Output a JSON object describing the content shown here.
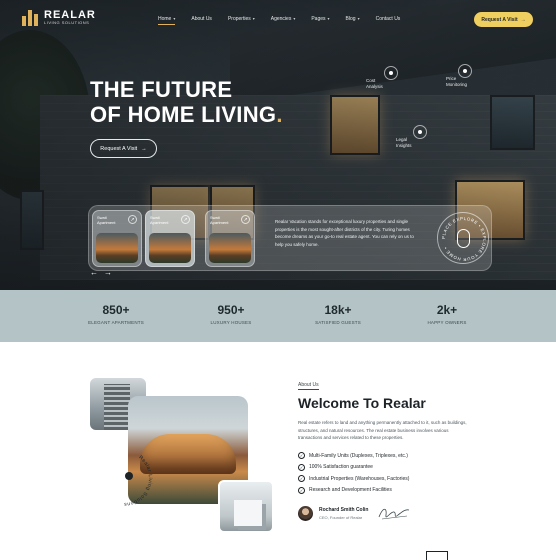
{
  "brand": {
    "name": "REALAR",
    "tagline": "LIVING SOLUTIONS",
    "accent": "#e0b25c",
    "cta_color": "#f0cf61"
  },
  "nav": {
    "items": [
      {
        "label": "Home",
        "dropdown": true,
        "active": true
      },
      {
        "label": "About Us",
        "dropdown": false
      },
      {
        "label": "Properties",
        "dropdown": true
      },
      {
        "label": "Agencies",
        "dropdown": true
      },
      {
        "label": "Pages",
        "dropdown": true
      },
      {
        "label": "Blog",
        "dropdown": true
      },
      {
        "label": "Contact Us",
        "dropdown": false
      }
    ],
    "cta_label": "Request A Visit",
    "caret": "▾",
    "arrow": "→"
  },
  "hero": {
    "title_line1": "THE FUTURE",
    "title_line2": "OF HOME LIVING",
    "title_dot": ".",
    "button_label": "Request A Visit",
    "hotspots": [
      {
        "label": "Cost Analysis"
      },
      {
        "label": "Price Monitoring"
      },
      {
        "label": "Legal Insights"
      }
    ],
    "cards": [
      {
        "label": "Swati Apartment"
      },
      {
        "label": "Swati Apartment"
      },
      {
        "label": "Swati Apartment"
      }
    ],
    "description": "Realar Vacation stands for exceptional luxury properties and single properties is the most sought-after districts of the city. Turing homes become dreams as your go-to real estate agent. You can rely on us to help you safely home.",
    "explore_text": "PLACE EXPLORE • EXPLORE YOUR HOME •",
    "slider_prev": "←",
    "slider_next": "→"
  },
  "stats": [
    {
      "value": "850+",
      "label": "ELEGANT APARTMENTS"
    },
    {
      "value": "950+",
      "label": "LUXURY HOUSES"
    },
    {
      "value": "18k+",
      "label": "SATISFIED GUESTS"
    },
    {
      "value": "2k+",
      "label": "HAPPY OWNERS"
    }
  ],
  "about": {
    "tag": "About Us",
    "title": "Welcome To Realar",
    "description": "Real estate refers to land and anything permanently attached to it, such as buildings, structures, and natural resources. The real estate business involves various transactions and services related to these properties.",
    "ring_text": "Realar Living Solutions",
    "features": [
      "Multi-Family Units (Duplexes, Triplexes, etc.)",
      "100% Satisfaction guarantee",
      "Industrial Properties (Warehouses, Factories)",
      "Research and Development Facilities"
    ],
    "check_glyph": "✓",
    "author_name": "Rochard Smith Colin",
    "author_role": "CEO, Founder of Realar"
  }
}
